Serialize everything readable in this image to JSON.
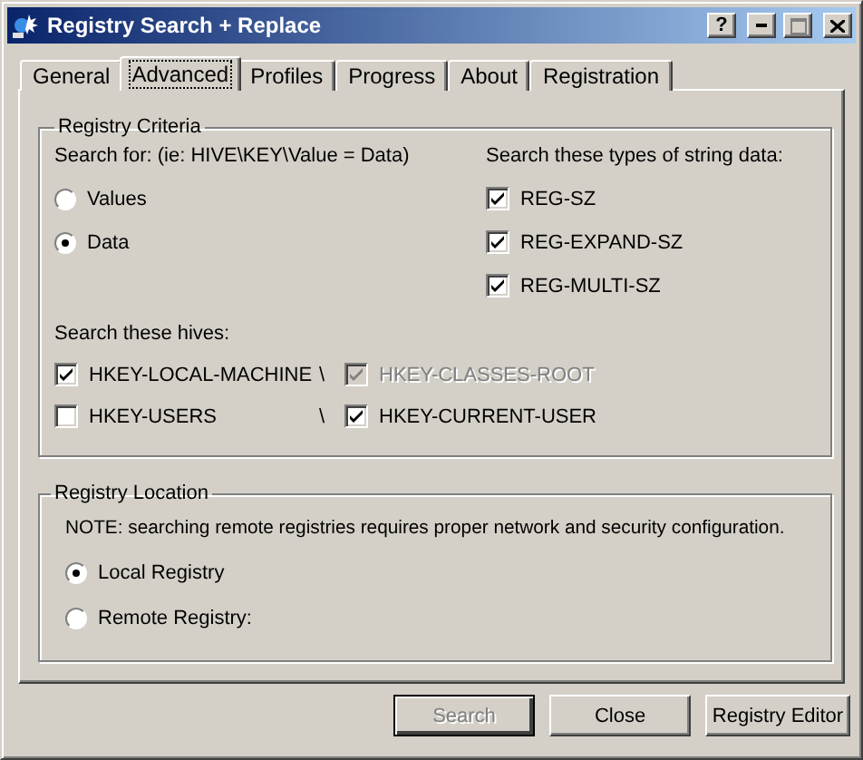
{
  "window": {
    "title": "Registry Search + Replace",
    "help_button": "?"
  },
  "tabs": [
    {
      "label": "General",
      "selected": false
    },
    {
      "label": "Advanced",
      "selected": true
    },
    {
      "label": "Profiles",
      "selected": false
    },
    {
      "label": "Progress",
      "selected": false
    },
    {
      "label": "About",
      "selected": false
    },
    {
      "label": "Registration",
      "selected": false
    }
  ],
  "criteria": {
    "title": "Registry Criteria",
    "search_for_label": "Search for: (ie: HIVE\\KEY\\Value = Data)",
    "search_for_options": [
      {
        "label": "Values",
        "selected": false
      },
      {
        "label": "Data",
        "selected": true
      }
    ],
    "types_label": "Search these types of string data:",
    "types": [
      {
        "label": "REG-SZ",
        "checked": true
      },
      {
        "label": "REG-EXPAND-SZ",
        "checked": true
      },
      {
        "label": "REG-MULTI-SZ",
        "checked": true
      }
    ],
    "hives_label": "Search these hives:",
    "hive_rows": [
      {
        "left": {
          "label": "HKEY-LOCAL-MACHINE",
          "checked": true,
          "disabled": false
        },
        "separator": "\\",
        "right": {
          "label": "HKEY-CLASSES-ROOT",
          "checked": true,
          "disabled": true
        }
      },
      {
        "left": {
          "label": "HKEY-USERS",
          "checked": false,
          "disabled": false
        },
        "separator": "\\",
        "right": {
          "label": "HKEY-CURRENT-USER",
          "checked": true,
          "disabled": false
        }
      }
    ]
  },
  "location": {
    "title": "Registry Location",
    "note": "NOTE: searching remote registries requires proper network and security configuration.",
    "options": [
      {
        "label": "Local Registry",
        "selected": true
      },
      {
        "label": "Remote Registry:",
        "selected": false
      }
    ]
  },
  "buttons": [
    {
      "label": "Search",
      "disabled": true,
      "default": true
    },
    {
      "label": "Close",
      "disabled": false,
      "default": false
    },
    {
      "label": "Registry Editor",
      "disabled": false,
      "default": false
    }
  ]
}
